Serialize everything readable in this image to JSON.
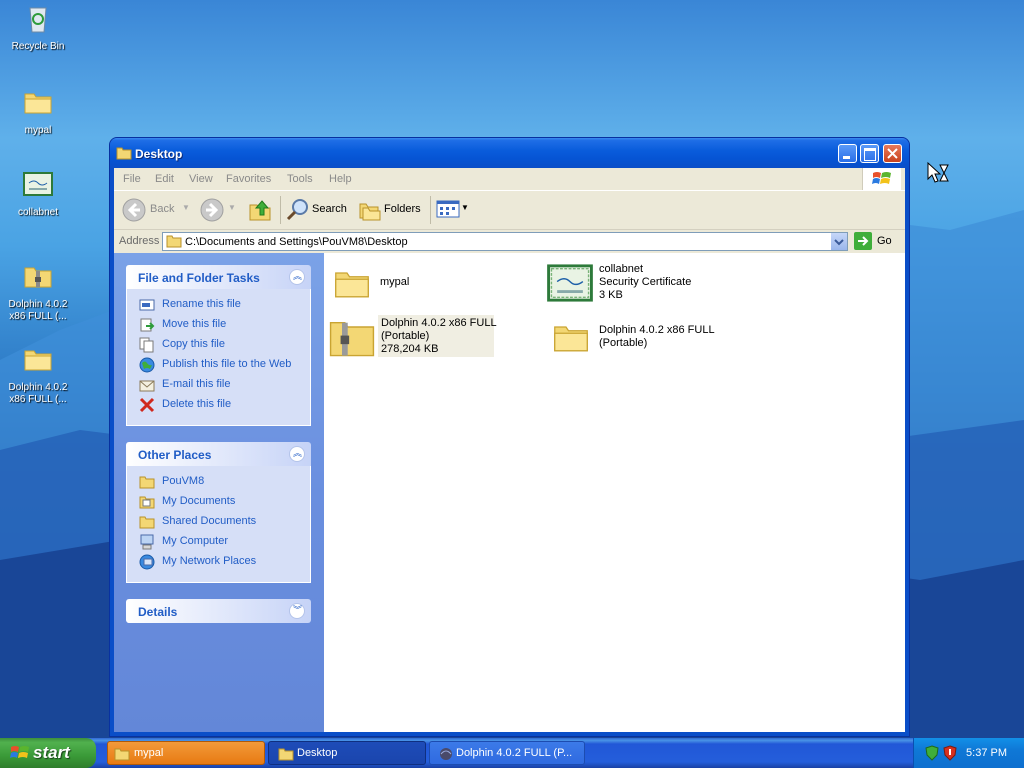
{
  "desktop": {
    "icons": [
      {
        "label": "Recycle Bin",
        "icon": "recycle-bin-icon"
      },
      {
        "label": "mypal",
        "icon": "folder-icon"
      },
      {
        "label": "collabnet",
        "icon": "certificate-icon"
      },
      {
        "label": "Dolphin 4.0.2\nx86 FULL (...",
        "icon": "zip-folder-icon"
      },
      {
        "label": "Dolphin 4.0.2\nx86 FULL (...",
        "icon": "folder-icon"
      }
    ]
  },
  "window": {
    "title": "Desktop",
    "menu": [
      "File",
      "Edit",
      "View",
      "Favorites",
      "Tools",
      "Help"
    ],
    "toolbar": {
      "back_label": "Back",
      "search_label": "Search",
      "folders_label": "Folders"
    },
    "address": {
      "label": "Address",
      "value": "C:\\Documents and Settings\\PouVM8\\Desktop",
      "go_label": "Go"
    },
    "tasks_panel": {
      "title": "File and Folder Tasks",
      "items": [
        {
          "label": "Rename this file",
          "icon": "rename-icon"
        },
        {
          "label": "Move this file",
          "icon": "move-icon"
        },
        {
          "label": "Copy this file",
          "icon": "copy-icon"
        },
        {
          "label": "Publish this file to the Web",
          "icon": "globe-icon"
        },
        {
          "label": "E-mail this file",
          "icon": "email-icon"
        },
        {
          "label": "Delete this file",
          "icon": "delete-icon"
        }
      ]
    },
    "places_panel": {
      "title": "Other Places",
      "items": [
        {
          "label": "PouVM8",
          "icon": "folder-icon"
        },
        {
          "label": "My Documents",
          "icon": "my-documents-icon"
        },
        {
          "label": "Shared Documents",
          "icon": "shared-folder-icon"
        },
        {
          "label": "My Computer",
          "icon": "my-computer-icon"
        },
        {
          "label": "My Network Places",
          "icon": "network-places-icon"
        }
      ]
    },
    "details_panel": {
      "title": "Details"
    },
    "files": [
      {
        "name": "mypal",
        "line2": "",
        "line3": "",
        "icon": "folder-icon"
      },
      {
        "name": "collabnet",
        "line2": "Security Certificate",
        "line3": "3 KB",
        "icon": "certificate-icon"
      },
      {
        "name": "Dolphin 4.0.2 x86 FULL",
        "line2": "(Portable)",
        "line3": "278,204 KB",
        "icon": "zip-folder-icon"
      },
      {
        "name": "Dolphin 4.0.2 x86 FULL",
        "line2": "(Portable)",
        "line3": "",
        "icon": "folder-icon"
      }
    ]
  },
  "taskbar": {
    "start_label": "start",
    "buttons": [
      {
        "label": "mypal",
        "icon": "folder-icon"
      },
      {
        "label": "Desktop",
        "icon": "folder-icon"
      },
      {
        "label": "Dolphin 4.0.2 FULL (P...",
        "icon": "dolphin-icon"
      }
    ],
    "clock": "5:37 PM"
  },
  "colors": {
    "titlebar": "#0a5ddc",
    "taskbar": "#245edb",
    "start": "#3a9a38",
    "task_active": "#e87a12",
    "link": "#215dc6"
  }
}
